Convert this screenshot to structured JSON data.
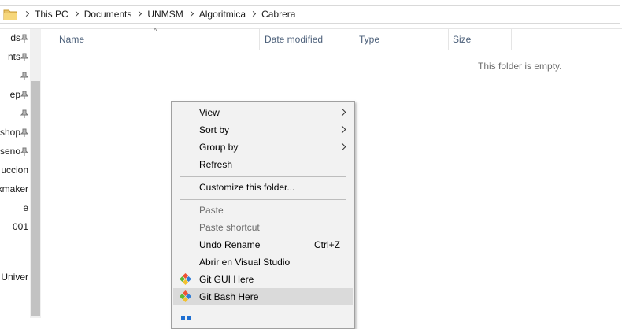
{
  "address_bar": {
    "crumbs": [
      "This PC",
      "Documents",
      "UNMSM",
      "Algoritmica",
      "Cabrera"
    ]
  },
  "nav_pane": {
    "items": [
      {
        "label": "ds",
        "pinned": true
      },
      {
        "label": "nts",
        "pinned": true
      },
      {
        "label": "",
        "pinned": true
      },
      {
        "label": "ep",
        "pinned": true
      },
      {
        "label": "",
        "pinned": true
      },
      {
        "label": "shop",
        "pinned": true
      },
      {
        "label": "seno",
        "pinned": true
      },
      {
        "label": "uccion",
        "pinned": false
      },
      {
        "label": "xmaker",
        "pinned": false
      },
      {
        "label": "e",
        "pinned": false
      },
      {
        "label": "001",
        "pinned": false
      },
      {
        "label": "",
        "pinned": false
      },
      {
        "label": "Univer",
        "pinned": false
      }
    ]
  },
  "columns": {
    "name": "Name",
    "date_modified": "Date modified",
    "type": "Type",
    "size": "Size",
    "sort_arrow": "^"
  },
  "empty_message": "This folder is empty.",
  "context_menu": {
    "view": "View",
    "sort_by": "Sort by",
    "group_by": "Group by",
    "refresh": "Refresh",
    "customize": "Customize this folder...",
    "paste": "Paste",
    "paste_shortcut": "Paste shortcut",
    "undo_rename": "Undo Rename",
    "undo_shortcut": "Ctrl+Z",
    "open_vs": "Abrir en Visual Studio",
    "git_gui": "Git GUI Here",
    "git_bash": "Git Bash Here"
  },
  "colors": {
    "menu_bg": "#f2f2f2",
    "menu_hover": "#dadada",
    "header_text": "#4c607a",
    "disabled_text": "#6d6d6d"
  }
}
